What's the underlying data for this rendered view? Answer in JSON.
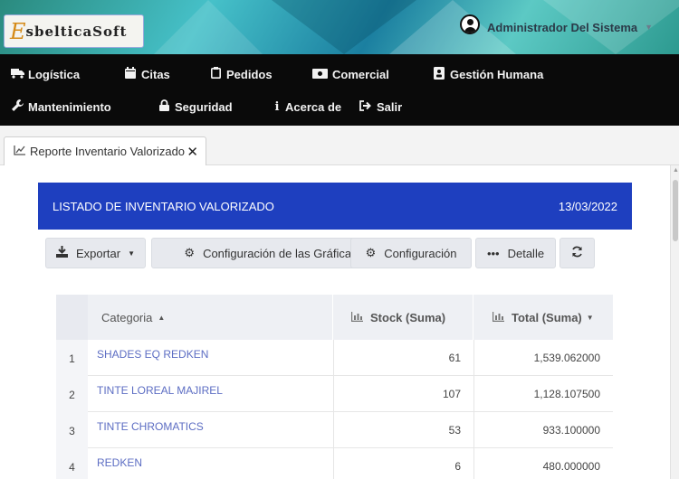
{
  "header": {
    "logo_initial": "E",
    "logo_text": "sbelticaSoft",
    "user_name": "Administrador Del Sistema"
  },
  "nav": {
    "items": [
      {
        "label": "Logística",
        "icon": "truck-icon"
      },
      {
        "label": "Citas",
        "icon": "calendar-icon"
      },
      {
        "label": "Pedidos",
        "icon": "clipboard-icon"
      },
      {
        "label": "Comercial",
        "icon": "money-icon"
      },
      {
        "label": "Gestión Humana",
        "icon": "id-card-icon"
      },
      {
        "label": "Mantenimiento",
        "icon": "wrench-icon"
      },
      {
        "label": "Seguridad",
        "icon": "lock-icon"
      },
      {
        "label": "Acerca de",
        "icon": "info-icon"
      },
      {
        "label": "Salir",
        "icon": "sign-out-icon"
      }
    ]
  },
  "tab": {
    "label": "Reporte Inventario Valorizado"
  },
  "card": {
    "title": "LISTADO DE INVENTARIO VALORIZADO",
    "date": "13/03/2022"
  },
  "toolbar": {
    "export_label": "Exportar",
    "chart_config_label": "Configuración de las Gráficas",
    "config_label": "Configuración",
    "detail_label": "Detalle"
  },
  "grid": {
    "columns": {
      "category": "Categoria",
      "stock": "Stock (Suma)",
      "total": "Total (Suma)"
    },
    "rows": [
      {
        "num": "1",
        "category": "SHADES EQ REDKEN",
        "stock": "61",
        "total": "1,539.062000"
      },
      {
        "num": "2",
        "category": "TINTE LOREAL MAJIREL",
        "stock": "107",
        "total": "1,128.107500"
      },
      {
        "num": "3",
        "category": "TINTE CHROMATICS",
        "stock": "53",
        "total": "933.100000"
      },
      {
        "num": "4",
        "category": "REDKEN",
        "stock": "6",
        "total": "480.000000"
      }
    ]
  },
  "colors": {
    "accent": "#1e3fbf",
    "nav_bg": "#0a0a0a",
    "link": "#5c6dc3"
  }
}
